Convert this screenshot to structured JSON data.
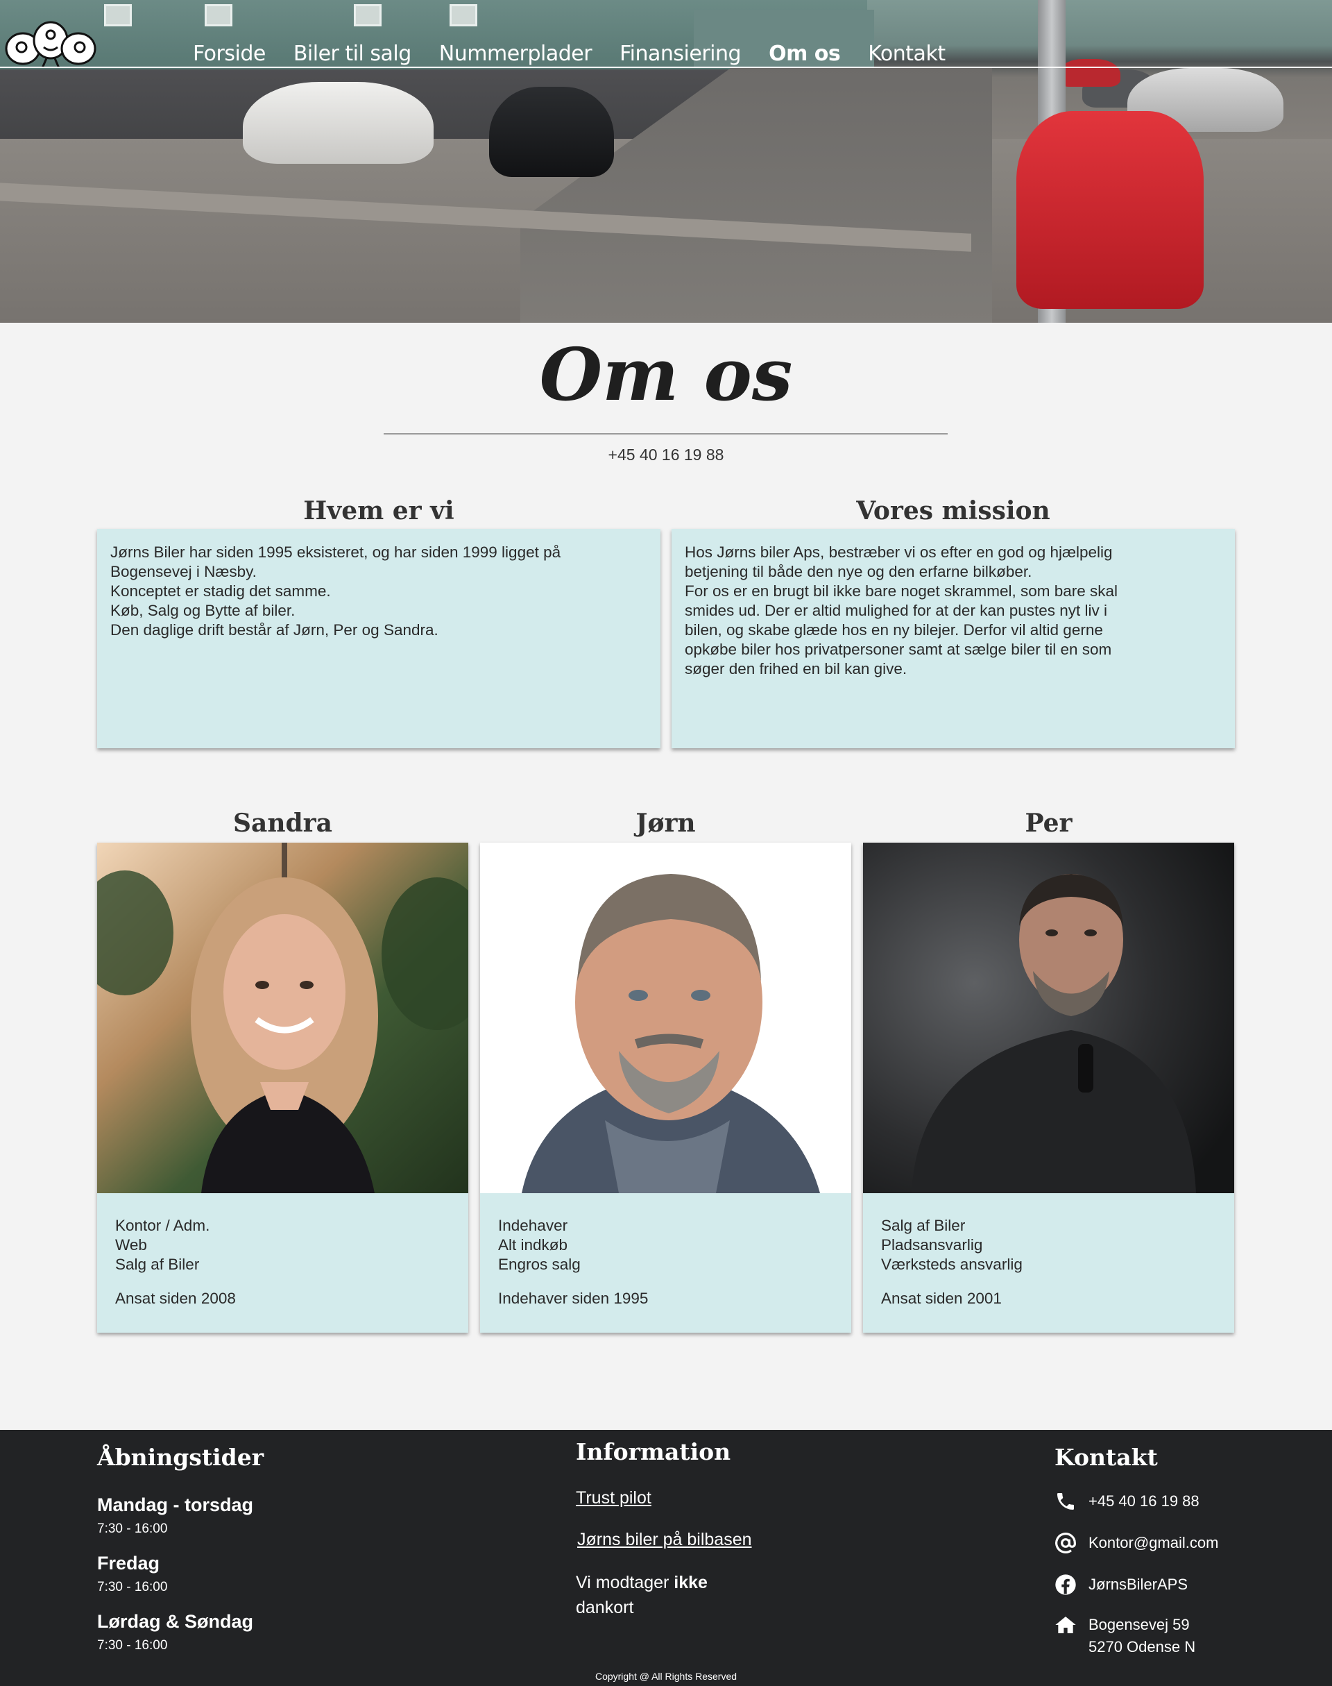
{
  "nav": {
    "items": [
      {
        "label": "Forside",
        "active": false
      },
      {
        "label": "Biler til salg",
        "active": false
      },
      {
        "label": "Nummerplader",
        "active": false
      },
      {
        "label": "Finansiering",
        "active": false
      },
      {
        "label": "Om os",
        "active": true
      },
      {
        "label": "Kontakt",
        "active": false
      }
    ]
  },
  "page": {
    "title": "Om os",
    "phone": "+45 40 16 19 88"
  },
  "about": {
    "who_heading": "Hvem er vi",
    "who_text": "Jørns Biler har siden 1995 eksisteret, og har siden 1999 ligget på\nBogensevej i Næsby.\nKonceptet er stadig det samme.\nKøb, Salg og Bytte af biler.\nDen daglige drift består af Jørn, Per og Sandra.",
    "mission_heading": "Vores mission",
    "mission_text": "Hos Jørns biler Aps, bestræber vi os efter en god og hjælpelig\nbetjening til både den nye og den erfarne bilkøber.\nFor os er en brugt bil ikke bare noget skrammel, som bare skal\nsmides ud. Der er altid mulighed for at der kan pustes nyt liv i\nbilen, og skabe glæde hos en ny bilejer. Derfor vil altid gerne\nopkøbe biler hos privatpersoner samt at sælge biler til en som\nsøger den frihed en bil kan give."
  },
  "people": [
    {
      "name": "Sandra",
      "duties": [
        "Kontor / Adm.",
        "Web",
        "Salg af Biler"
      ],
      "since": "Ansat siden 2008"
    },
    {
      "name": "Jørn",
      "duties": [
        "Indehaver",
        "Alt indkøb",
        "Engros salg"
      ],
      "since": "Indehaver siden 1995"
    },
    {
      "name": "Per",
      "duties": [
        "Salg af Biler",
        "Pladsansvarlig",
        "Værksteds ansvarlig"
      ],
      "since": "Ansat siden 2001"
    }
  ],
  "footer": {
    "hours_heading": "Åbningstider",
    "hours": [
      {
        "day": "Mandag - torsdag",
        "time": "7:30 - 16:00"
      },
      {
        "day": "Fredag",
        "time": "7:30 - 16:00"
      },
      {
        "day": "Lørdag & Søndag",
        "time": "7:30 - 16:00"
      }
    ],
    "info_heading": "Information",
    "links": [
      "Trust pilot",
      "Jørns biler på bilbasen"
    ],
    "dankort_pre": "Vi modtager ",
    "dankort_bold": "ikke",
    "dankort_post": "dankort",
    "contact_heading": "Kontakt",
    "contact": {
      "phone": "+45 40 16 19 88",
      "email": "Kontor@gmail.com",
      "facebook": "JørnsBilerAPS",
      "address_line1": "Bogensevej 59",
      "address_line2": "5270 Odense N"
    },
    "copyright": "Copyright @ All Rights Reserved"
  },
  "icons": {
    "phone": "phone-icon",
    "email": "at-sign-icon",
    "facebook": "facebook-icon",
    "address": "home-icon"
  },
  "colors": {
    "card_bg": "#d3ebec",
    "footer_bg": "#222325",
    "page_bg": "#f3f3f3"
  }
}
